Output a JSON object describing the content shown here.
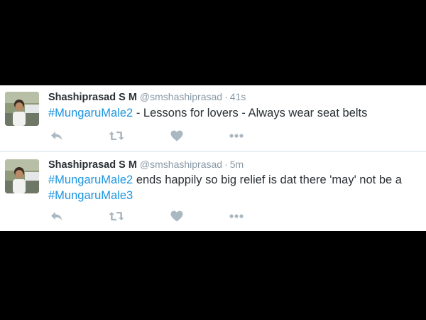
{
  "tweets": [
    {
      "author": {
        "display_name": "Shashiprasad S M",
        "handle": "@smshashiprasad"
      },
      "separator": "·",
      "timestamp": "41s",
      "hashtag": "#MungaruMale2",
      "text_after": " - Lessons for lovers - Always wear seat belts",
      "actions": [
        "reply-icon",
        "retweet-icon",
        "like-icon",
        "more-icon"
      ]
    },
    {
      "author": {
        "display_name": "Shashiprasad S M",
        "handle": "@smshashiprasad"
      },
      "separator": "·",
      "timestamp": "5m",
      "hashtag": "#MungaruMale2",
      "text_after": " ends happily so big relief is dat there 'may' not be a ",
      "hashtag_2": "#MungaruMale3",
      "actions": [
        "reply-icon",
        "retweet-icon",
        "like-icon",
        "more-icon"
      ]
    }
  ],
  "colors": {
    "background": "#000000",
    "card": "#ffffff",
    "text": "#292f33",
    "muted": "#8899a6",
    "link": "#1b95e0",
    "icon": "#aab8c2"
  }
}
